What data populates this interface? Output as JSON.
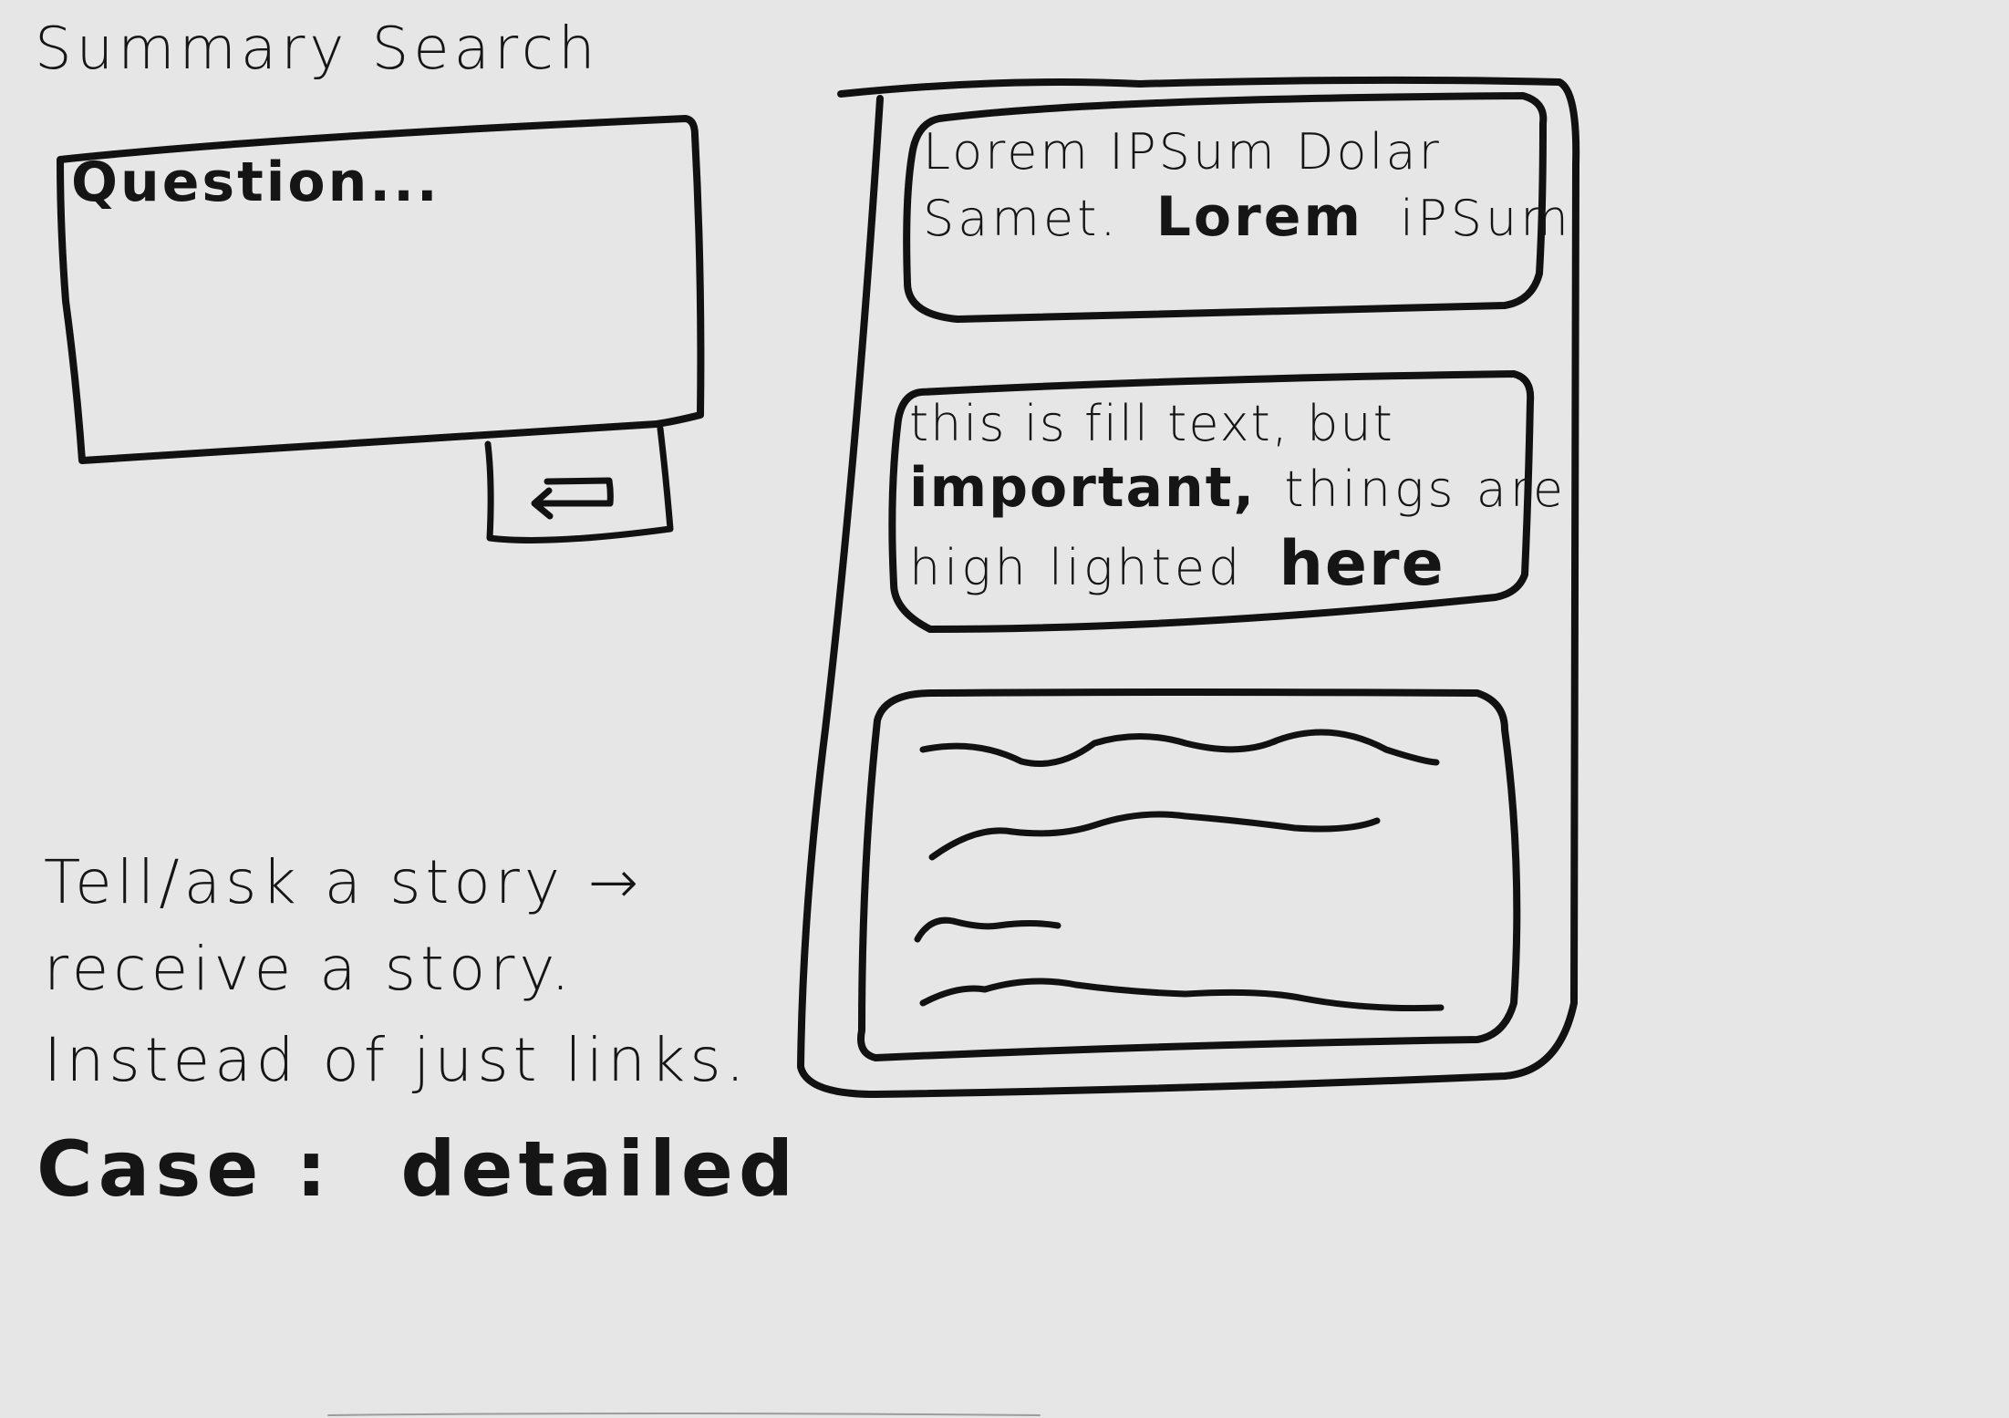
{
  "title": "Summary Search",
  "search": {
    "placeholder": "Question...",
    "submit_icon": "enter-arrow-icon"
  },
  "results": {
    "card_1": {
      "line_1": "Lorem IPSum Dolar",
      "line_2_a": "Samet.",
      "line_2_bold": "Lorem",
      "line_2_b": "iPSum"
    },
    "card_2": {
      "line_1": "this is fill text, but",
      "line_2_bold": "important,",
      "line_2_b": "things are",
      "line_3_a": "high lighted",
      "line_3_bold": "here"
    },
    "card_3_icon": "placeholder-text-squiggle"
  },
  "notes": {
    "line_1": "Tell/ask a story →",
    "line_2": "receive a story.",
    "line_3": "Instead of just links.",
    "case_label": "Case :",
    "case_value": "detailed"
  }
}
